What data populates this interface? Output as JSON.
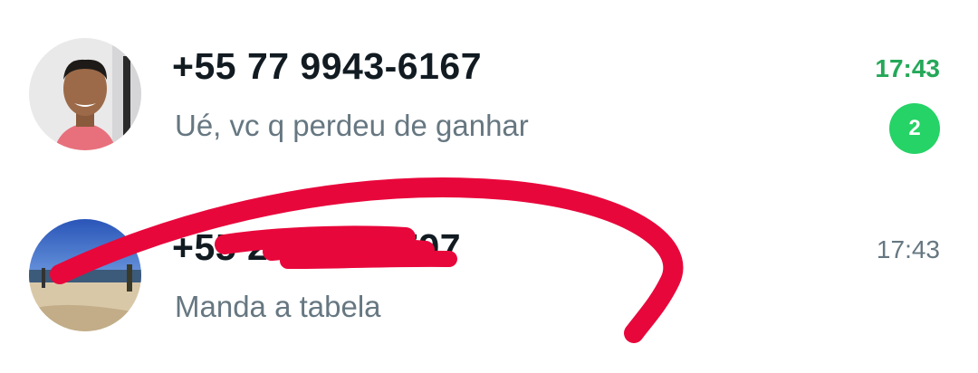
{
  "chats": [
    {
      "name": "+55 77 9943-6167",
      "preview": "Ué, vc q perdeu de ganhar",
      "time": "17:43",
      "unread_count": "2",
      "time_color": "#25a859",
      "badge_color": "#25d366"
    },
    {
      "name": "+55 2             5797",
      "preview": "Manda a tabela",
      "time": "17:43",
      "time_color": "#667781"
    }
  ],
  "annotation": {
    "color": "#e8073b",
    "description_icon": "red-scribble-redaction"
  }
}
